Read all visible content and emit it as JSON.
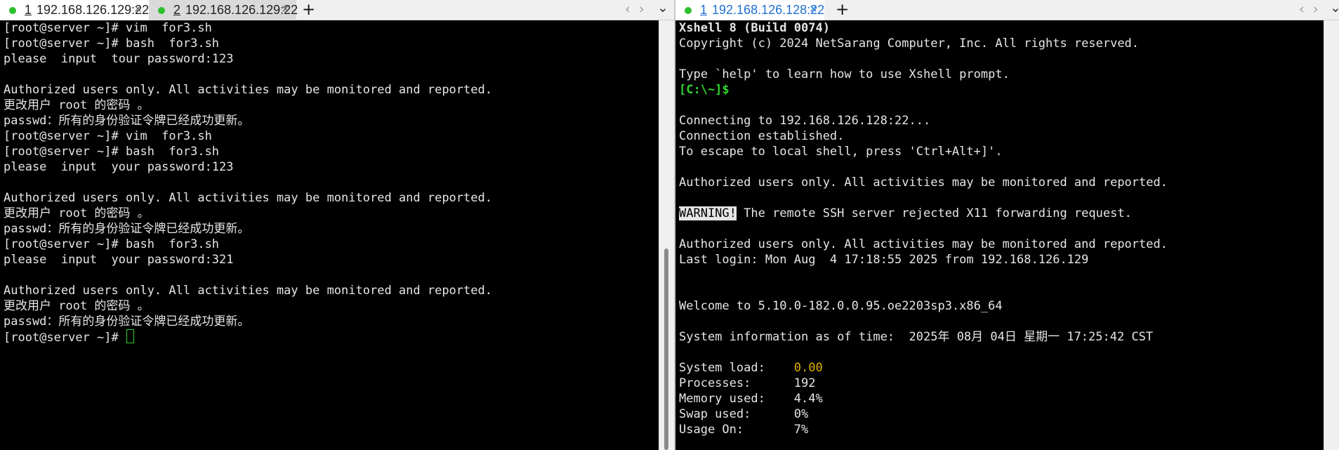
{
  "left_pane": {
    "tabs": [
      {
        "num": "1",
        "title": "192.168.126.129:22",
        "close": "×"
      },
      {
        "num": "2",
        "title": "192.168.126.129:22",
        "close": "×"
      }
    ],
    "add": "+",
    "nav_prev": "‹",
    "nav_next": "›",
    "nav_menu": "⌄",
    "lines": [
      {
        "text": "[root@server ~]# vim  for3.sh"
      },
      {
        "text": "[root@server ~]# bash  for3.sh"
      },
      {
        "text": "please  input  tour password:123"
      },
      {
        "text": ""
      },
      {
        "text": "Authorized users only. All activities may be monitored and reported."
      },
      {
        "text": "更改用户 root 的密码 。"
      },
      {
        "text": "passwd：所有的身份验证令牌已经成功更新。"
      },
      {
        "text": "[root@server ~]# vim  for3.sh"
      },
      {
        "text": "[root@server ~]# bash  for3.sh"
      },
      {
        "text": "please  input  your password:123"
      },
      {
        "text": ""
      },
      {
        "text": "Authorized users only. All activities may be monitored and reported."
      },
      {
        "text": "更改用户 root 的密码 。"
      },
      {
        "text": "passwd：所有的身份验证令牌已经成功更新。"
      },
      {
        "text": "[root@server ~]# bash  for3.sh"
      },
      {
        "text": "please  input  your password:321"
      },
      {
        "text": ""
      },
      {
        "text": "Authorized users only. All activities may be monitored and reported."
      },
      {
        "text": "更改用户 root 的密码 。"
      },
      {
        "text": "passwd：所有的身份验证令牌已经成功更新。"
      }
    ],
    "prompt": "[root@server ~]# "
  },
  "right_pane": {
    "tab": {
      "num": "1",
      "title": "192.168.126.128:22",
      "close": "×"
    },
    "add": "+",
    "nav_prev": "‹",
    "nav_next": "›",
    "nav_menu": "⌄",
    "lines": [
      {
        "text": "Xshell 8 (Build 0074)",
        "style": "bold"
      },
      {
        "text": "Copyright (c) 2024 NetSarang Computer, Inc. All rights reserved."
      },
      {
        "text": ""
      },
      {
        "text": "Type `help' to learn how to use Xshell prompt."
      },
      {
        "text": "[C:\\~]$",
        "style": "green"
      },
      {
        "text": ""
      },
      {
        "text": "Connecting to 192.168.126.128:22..."
      },
      {
        "text": "Connection established."
      },
      {
        "text": "To escape to local shell, press 'Ctrl+Alt+]'."
      },
      {
        "text": ""
      },
      {
        "text": "Authorized users only. All activities may be monitored and reported."
      },
      {
        "text": ""
      },
      {
        "prefix": "WARNING!",
        "text": " The remote SSH server rejected X11 forwarding request."
      },
      {
        "text": ""
      },
      {
        "text": "Authorized users only. All activities may be monitored and reported."
      },
      {
        "text": "Last login: Mon Aug  4 17:18:55 2025 from 192.168.126.129"
      },
      {
        "text": ""
      },
      {
        "text": ""
      },
      {
        "text": "Welcome to 5.10.0-182.0.0.95.oe2203sp3.x86_64"
      },
      {
        "text": ""
      },
      {
        "text": "System information as of time:  2025年 08月 04日 星期一 17:25:42 CST"
      },
      {
        "text": ""
      },
      {
        "label": "System load:    ",
        "value": "0.00",
        "value_style": "yellow"
      },
      {
        "label": "Processes:      ",
        "value": "192"
      },
      {
        "label": "Memory used:    ",
        "value": "4.4%"
      },
      {
        "label": "Swap used:      ",
        "value": "0%"
      },
      {
        "label": "Usage On:       ",
        "value": "7%"
      }
    ]
  },
  "colors": {
    "prompt_green": "#2ed42e",
    "load_yellow": "#e0b000",
    "tab_blue": "#1f6fd1",
    "status_dot": "#2cc02c"
  }
}
